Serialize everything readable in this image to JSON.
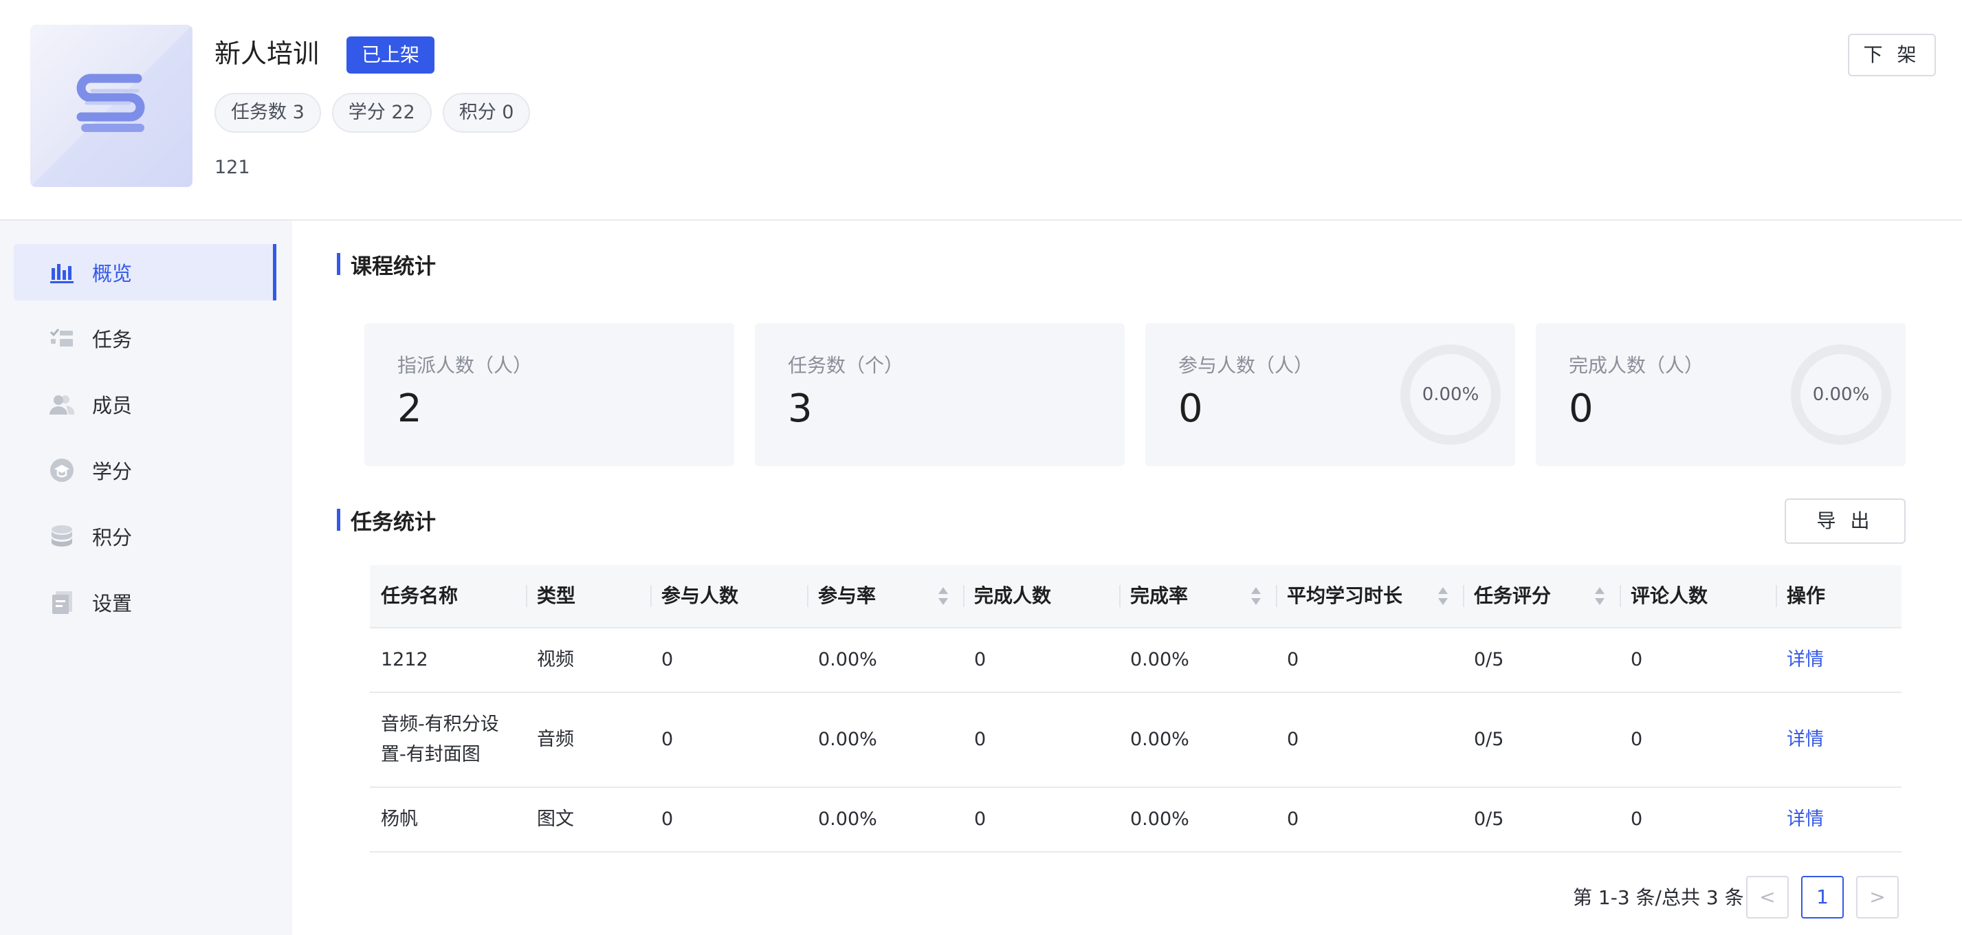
{
  "header": {
    "title": "新人培训",
    "status": "已上架",
    "chips": [
      "任务数 3",
      "学分 22",
      "积分 0"
    ],
    "description": "121",
    "action_label": "下 架"
  },
  "sidebar": {
    "items": [
      {
        "label": "概览",
        "icon": "bar-chart-icon",
        "active": true
      },
      {
        "label": "任务",
        "icon": "task-list-icon"
      },
      {
        "label": "成员",
        "icon": "members-icon"
      },
      {
        "label": "学分",
        "icon": "credit-icon"
      },
      {
        "label": "积分",
        "icon": "points-icon"
      },
      {
        "label": "设置",
        "icon": "settings-icon"
      }
    ]
  },
  "course_stats": {
    "title": "课程统计",
    "cards": [
      {
        "label": "指派人数（人）",
        "value": "2"
      },
      {
        "label": "任务数（个）",
        "value": "3"
      },
      {
        "label": "参与人数（人）",
        "value": "0",
        "rate": "0.00%"
      },
      {
        "label": "完成人数（人）",
        "value": "0",
        "rate": "0.00%"
      }
    ]
  },
  "task_stats": {
    "title": "任务统计",
    "export_label": "导 出",
    "columns": [
      "任务名称",
      "类型",
      "参与人数",
      "参与率",
      "完成人数",
      "完成率",
      "平均学习时长",
      "任务评分",
      "评论人数",
      "操作"
    ],
    "rows": [
      [
        "1212",
        "视频",
        "0",
        "0.00%",
        "0",
        "0.00%",
        "0",
        "0/5",
        "0",
        "详情"
      ],
      [
        "音频-有积分设置-有封面图",
        "音频",
        "0",
        "0.00%",
        "0",
        "0.00%",
        "0",
        "0/5",
        "0",
        "详情"
      ],
      [
        "杨帆",
        "图文",
        "0",
        "0.00%",
        "0",
        "0.00%",
        "0",
        "0/5",
        "0",
        "详情"
      ]
    ]
  },
  "pagination": {
    "summary": "第 1-3 条/总共 3 条",
    "prev": "<",
    "current": "1",
    "next": ">"
  },
  "colors": {
    "accent": "#3359e8",
    "sidebar_bg": "#f5f6f9",
    "card_bg": "#f5f6f9"
  }
}
